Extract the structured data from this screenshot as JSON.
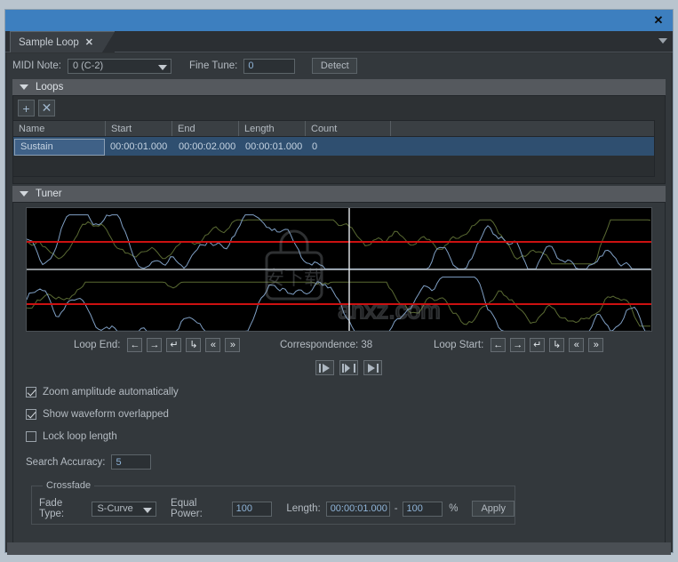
{
  "window": {
    "titlebar_close": "✕",
    "tabstrip_menu_icon": "chevron-down-icon"
  },
  "tab": {
    "label": "Sample Loop",
    "close": "✕"
  },
  "toolbar": {
    "midi_note_label": "MIDI Note:",
    "midi_note_value": "0 (C-2)",
    "fine_tune_label": "Fine Tune:",
    "fine_tune_value": "0",
    "detect_label": "Detect"
  },
  "loops": {
    "title": "Loops",
    "add_label": "+",
    "delete_label": "✕",
    "columns": [
      "Name",
      "Start",
      "End",
      "Length",
      "Count"
    ],
    "rows": [
      {
        "name": "Sustain",
        "start": "00:00:01.000",
        "end": "00:00:02.000",
        "length": "00:00:01.000",
        "count": "0"
      }
    ]
  },
  "tuner": {
    "title": "Tuner",
    "watermark_cn": "安下载",
    "watermark_en": "anxz.com",
    "loop_end_label": "Loop End:",
    "loop_start_label": "Loop Start:",
    "correspondence_label": "Correspondence: 38",
    "nav_buttons": [
      {
        "name": "step-left",
        "glyph": "←"
      },
      {
        "name": "step-right",
        "glyph": "→"
      },
      {
        "name": "snap-left",
        "glyph": "↵"
      },
      {
        "name": "snap-right",
        "glyph": "↳"
      },
      {
        "name": "jump-left",
        "glyph": "«"
      },
      {
        "name": "jump-right",
        "glyph": "»"
      }
    ],
    "transport": [
      {
        "name": "play-from-loop-start"
      },
      {
        "name": "play-loop"
      },
      {
        "name": "play-to-loop-end"
      }
    ],
    "checkboxes": [
      {
        "label": "Zoom amplitude automatically",
        "checked": true
      },
      {
        "label": "Show waveform overlapped",
        "checked": true
      },
      {
        "label": "Lock loop length",
        "checked": false
      }
    ],
    "search_accuracy_label": "Search Accuracy:",
    "search_accuracy_value": "5"
  },
  "crossfade": {
    "legend": "Crossfade",
    "fade_type_label": "Fade Type:",
    "fade_type_value": "S-Curve",
    "equal_power_label": "Equal Power:",
    "equal_power_value": "100",
    "length_label": "Length:",
    "length_value": "00:00:01.000",
    "length_dash": "-",
    "length_percent_value": "100",
    "percent_symbol": "%",
    "apply_label": "Apply"
  },
  "colors": {
    "titlebar": "#3d7fbf",
    "panel": "#33383c",
    "selection": "#2f4f70",
    "waveform_bg": "#000000",
    "waveform_center": "#cc1111",
    "trace_blue": "#7f9fc4",
    "trace_green": "#5a6a33"
  }
}
